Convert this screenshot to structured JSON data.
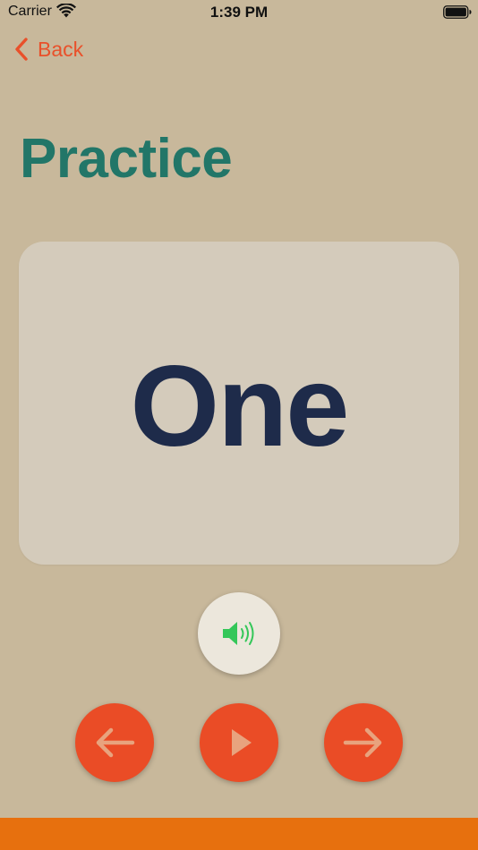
{
  "status_bar": {
    "carrier": "Carrier",
    "time": "1:39 PM",
    "wifi_icon": "wifi-icon",
    "battery_icon": "battery-icon"
  },
  "nav": {
    "back_label": "Back",
    "back_icon": "chevron-left-icon"
  },
  "page": {
    "title": "Practice"
  },
  "card": {
    "word": "One"
  },
  "controls": {
    "sound_icon": "speaker-icon",
    "prev_icon": "arrow-left-icon",
    "play_icon": "play-icon",
    "next_icon": "arrow-right-icon"
  },
  "colors": {
    "background": "#c8b89b",
    "title": "#227668",
    "accent": "#ea4c26",
    "card": "#d4cbbb",
    "word": "#1e2b4a",
    "speaker": "#34c759",
    "bottom_bar": "#e7700e"
  }
}
